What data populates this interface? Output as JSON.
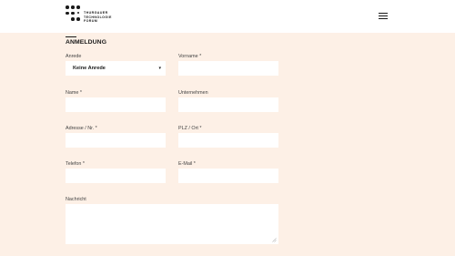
{
  "header": {
    "logo_lines": [
      "THURGAUER",
      "TECHNOLOGIE",
      "FORUM"
    ],
    "menu_icon": "hamburger-menu-icon"
  },
  "form": {
    "section_title": "ANMELDUNG",
    "fields": {
      "anrede": {
        "label": "Anrede",
        "value": "Keine Anrede"
      },
      "vorname": {
        "label": "Vorname *",
        "value": ""
      },
      "name": {
        "label": "Name *",
        "value": ""
      },
      "unternehmen": {
        "label": "Unternehmen",
        "value": ""
      },
      "adresse": {
        "label": "Adresse / Nr. *",
        "value": ""
      },
      "plz_ort": {
        "label": "PLZ / Ort *",
        "value": ""
      },
      "telefon": {
        "label": "Telefon *",
        "value": ""
      },
      "email": {
        "label": "E-Mail *",
        "value": ""
      },
      "nachricht": {
        "label": "Nachricht",
        "value": ""
      }
    }
  },
  "colors": {
    "page_background": "#fdf0e6",
    "header_background": "#ffffff",
    "field_background": "#ffffff",
    "text": "#1a1a1a"
  }
}
